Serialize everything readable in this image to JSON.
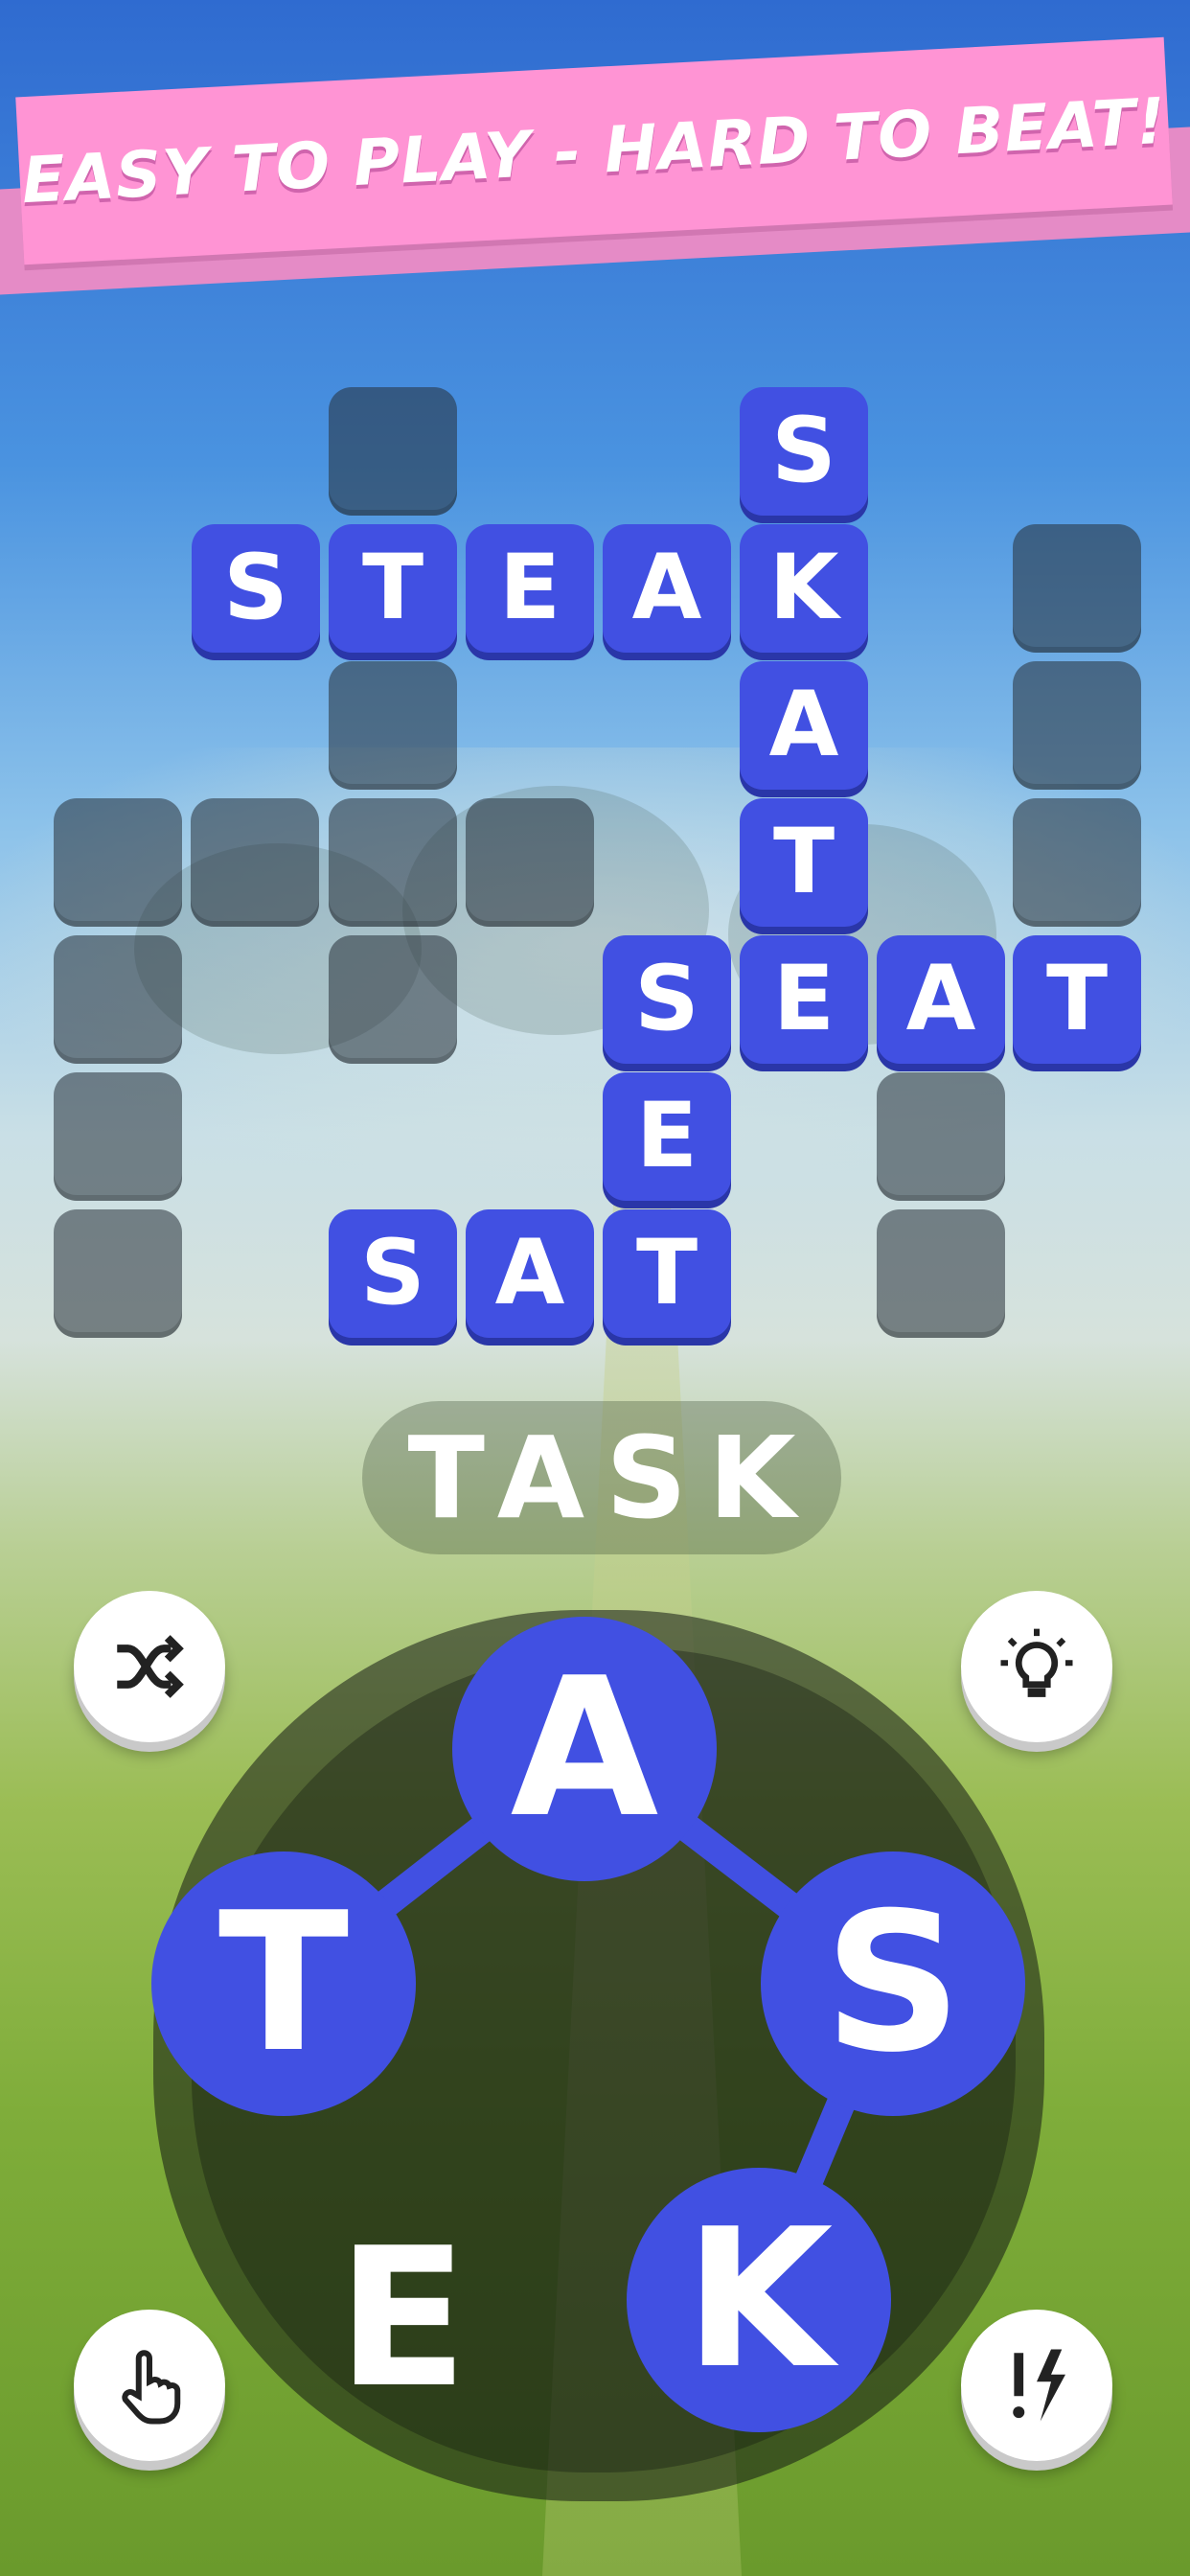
{
  "banner": {
    "text": "EASY TO PLAY - HARD TO BEAT!"
  },
  "board": {
    "filled_words": [
      "STEAK",
      "SKATE",
      "SEAT",
      "SET",
      "SAT"
    ],
    "cells": {
      "r1c6": "S",
      "r2c2": "S",
      "r2c3": "T",
      "r2c4": "E",
      "r2c5": "A",
      "r2c6": "K",
      "r3c6": "A",
      "r4c6": "T",
      "r5c5": "S",
      "r5c6": "E",
      "r5c7": "A",
      "r5c8": "T",
      "r6c5": "E",
      "r7c3": "S",
      "r7c4": "A",
      "r7c5": "T"
    }
  },
  "current_word": "TASK",
  "wheel": {
    "letters": {
      "a": "A",
      "s": "S",
      "k": "K",
      "e": "E",
      "t": "T"
    },
    "selected_path": [
      "T",
      "A",
      "S",
      "K"
    ]
  },
  "buttons": {
    "shuffle": "shuffle-icon",
    "hint": "lightbulb-icon",
    "finger": "pointing-hand-icon",
    "bonus": "exclamation-lightning-icon"
  },
  "colors": {
    "tile": "#4150e2",
    "banner": "#ff94d4"
  }
}
